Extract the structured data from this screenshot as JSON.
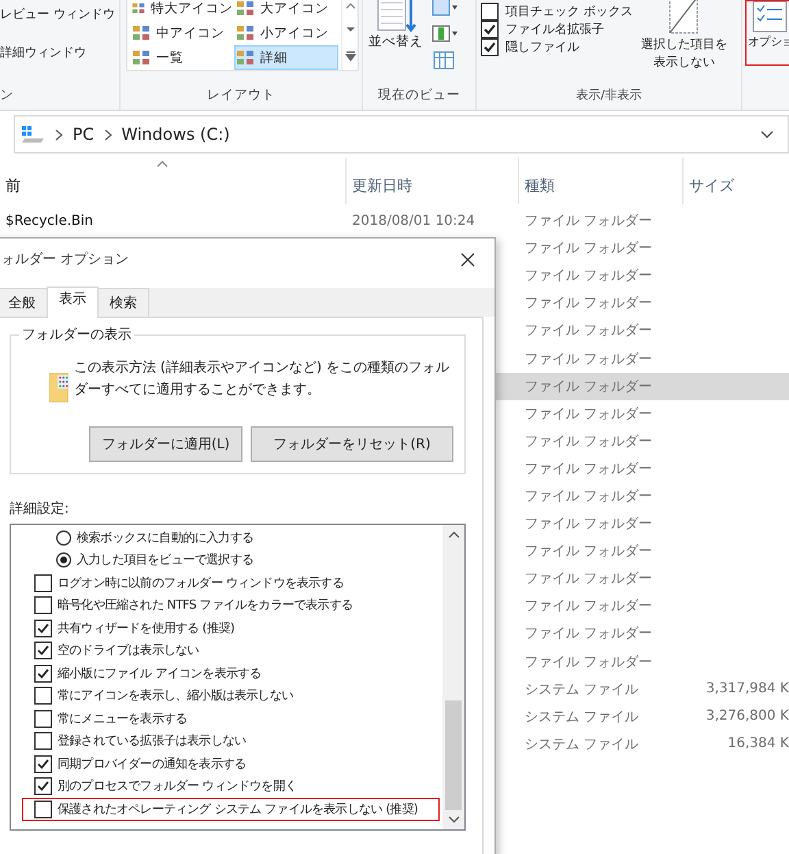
{
  "ribbon": {
    "pane_group": {
      "items": [
        "レビュー ウィンドウ",
        "詳細ウィンドウ"
      ],
      "label": "ン"
    },
    "layout_group": {
      "label": "レイアウト",
      "items": [
        {
          "label": "特大アイコン",
          "selected": false
        },
        {
          "label": "大アイコン",
          "selected": false
        },
        {
          "label": "中アイコン",
          "selected": false
        },
        {
          "label": "小アイコン",
          "selected": false
        },
        {
          "label": "一覧",
          "selected": false
        },
        {
          "label": "詳細",
          "selected": true
        }
      ]
    },
    "view_group": {
      "label": "現在のビュー",
      "sort_button": "並べ替え"
    },
    "show_hide_group": {
      "label": "表示/非表示",
      "checks": [
        {
          "label": "項目チェック ボックス",
          "checked": false
        },
        {
          "label": "ファイル名拡張子",
          "checked": true
        },
        {
          "label": "隠しファイル",
          "checked": true
        }
      ],
      "hide_button": [
        "選択した項目を",
        "表示しない"
      ]
    },
    "options_button": {
      "label": "オプショ",
      "highlighted": true
    }
  },
  "address_bar": {
    "path": [
      "PC",
      "Windows (C:)"
    ]
  },
  "file_list": {
    "columns": [
      {
        "label": "前",
        "sorted": true
      },
      {
        "label": "更新日時",
        "sorted": false
      },
      {
        "label": "種類",
        "sorted": false
      },
      {
        "label": "サイズ",
        "sorted": false
      }
    ],
    "rows": [
      {
        "name": "$Recycle.Bin",
        "date": "2018/08/01 10:24",
        "type": "ファイル フォルダー",
        "selected": false
      },
      {
        "type": "ファイル フォルダー",
        "selected": false
      },
      {
        "type": "ファイル フォルダー",
        "selected": false
      },
      {
        "type": "ファイル フォルダー",
        "selected": false
      },
      {
        "type": "ファイル フォルダー",
        "selected": false
      },
      {
        "type": "ファイル フォルダー",
        "selected": false
      },
      {
        "type": "ファイル フォルダー",
        "selected": true
      },
      {
        "type": "ファイル フォルダー",
        "selected": false
      },
      {
        "type": "ファイル フォルダー",
        "selected": false
      },
      {
        "type": "ファイル フォルダー",
        "selected": false
      },
      {
        "type": "ファイル フォルダー",
        "selected": false
      },
      {
        "type": "ファイル フォルダー",
        "selected": false
      },
      {
        "type": "ファイル フォルダー",
        "selected": false
      },
      {
        "type": "ファイル フォルダー",
        "selected": false
      },
      {
        "type": "ファイル フォルダー",
        "selected": false
      },
      {
        "type": "ファイル フォルダー",
        "selected": false
      },
      {
        "type": "ファイル フォルダー",
        "selected": false
      },
      {
        "type": "システム ファイル",
        "size": "3,317,984 K",
        "selected": false
      },
      {
        "type": "システム ファイル",
        "size": "3,276,800 K",
        "selected": false
      },
      {
        "type": "システム ファイル",
        "size": "16,384 K",
        "selected": false
      }
    ]
  },
  "dialog": {
    "title": "ォルダー オプション",
    "tabs": [
      {
        "label": "全般",
        "selected": false
      },
      {
        "label": "表示",
        "selected": true
      },
      {
        "label": "検索",
        "selected": false
      }
    ],
    "folder_views": {
      "title": "フォルダーの表示",
      "description": "この表示方法 (詳細表示やアイコンなど) をこの種類のフォルダーすべてに適用することができます。",
      "buttons": [
        "フォルダーに適用(L)",
        "フォルダーをリセット(R)"
      ]
    },
    "advanced_label": "詳細設定:",
    "settings": [
      {
        "kind": "radio",
        "label": "検索ボックスに自動的に入力する",
        "checked": false,
        "highlighted": false
      },
      {
        "kind": "radio",
        "label": "入力した項目をビューで選択する",
        "checked": true,
        "highlighted": false
      },
      {
        "kind": "checkbox",
        "label": "ログオン時に以前のフォルダー ウィンドウを表示する",
        "checked": false,
        "highlighted": false
      },
      {
        "kind": "checkbox",
        "label": "暗号化や圧縮された NTFS ファイルをカラーで表示する",
        "checked": false,
        "highlighted": false
      },
      {
        "kind": "checkbox",
        "label": "共有ウィザードを使用する (推奨)",
        "checked": true,
        "highlighted": false
      },
      {
        "kind": "checkbox",
        "label": "空のドライブは表示しない",
        "checked": true,
        "highlighted": false
      },
      {
        "kind": "checkbox",
        "label": "縮小版にファイル アイコンを表示する",
        "checked": true,
        "highlighted": false
      },
      {
        "kind": "checkbox",
        "label": "常にアイコンを表示し、縮小版は表示しない",
        "checked": false,
        "highlighted": false
      },
      {
        "kind": "checkbox",
        "label": "常にメニューを表示する",
        "checked": false,
        "highlighted": false
      },
      {
        "kind": "checkbox",
        "label": "登録されている拡張子は表示しない",
        "checked": false,
        "highlighted": false
      },
      {
        "kind": "checkbox",
        "label": "同期プロバイダーの通知を表示する",
        "checked": true,
        "highlighted": false
      },
      {
        "kind": "checkbox",
        "label": "別のプロセスでフォルダー ウィンドウを開く",
        "checked": true,
        "highlighted": false
      },
      {
        "kind": "checkbox",
        "label": "保護されたオペレーティング システム ファイルを表示しない (推奨)",
        "checked": false,
        "highlighted": true
      }
    ]
  }
}
